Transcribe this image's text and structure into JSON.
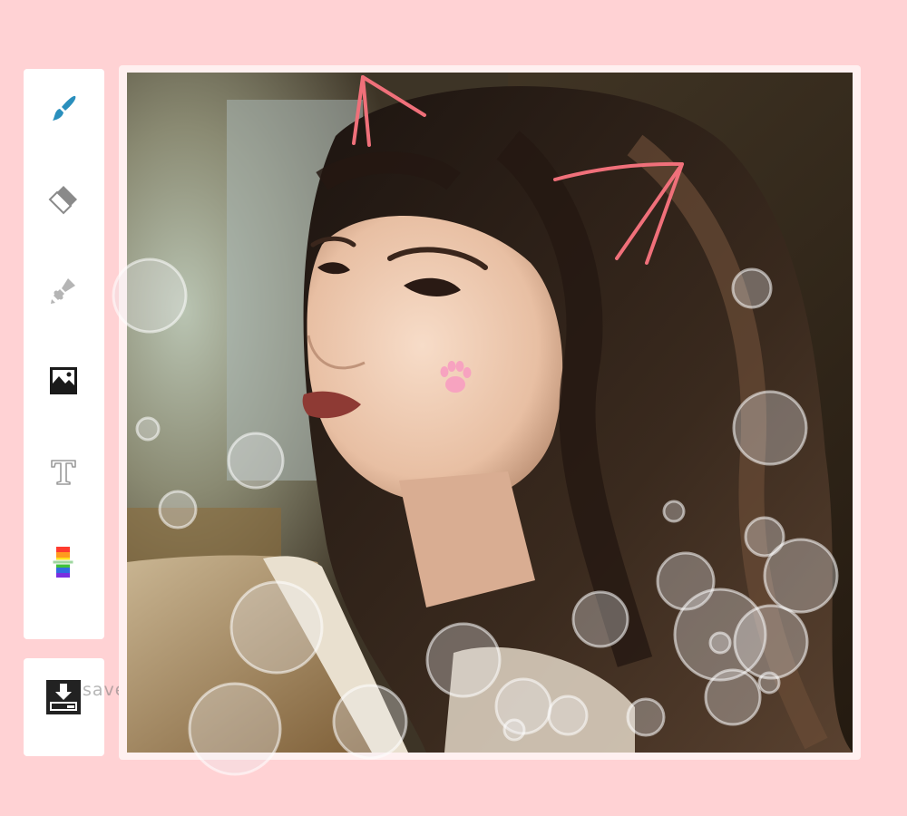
{
  "app": {
    "tools": [
      {
        "name": "brush",
        "icon": "paintbrush-icon",
        "color": "#2a8fbd",
        "selected": true
      },
      {
        "name": "eraser",
        "icon": "eraser-icon",
        "color": "#8a8a8a"
      },
      {
        "name": "stamp",
        "icon": "stamp-icon",
        "color": "#b5b5b5"
      },
      {
        "name": "image",
        "icon": "image-icon",
        "color": "#1a1a1a"
      },
      {
        "name": "text",
        "icon": "text-icon",
        "color": "#9a9a9a"
      },
      {
        "name": "color",
        "icon": "color-spectrum-icon",
        "color": "#ff4040"
      }
    ],
    "save": {
      "icon": "download-icon",
      "label": "save the picture"
    },
    "canvas": {
      "photo": "portrait-photo",
      "stroke_color": "#f0707a",
      "paw_sticker": "paw-print-icon",
      "paw_color": "#f7a3c0"
    }
  }
}
